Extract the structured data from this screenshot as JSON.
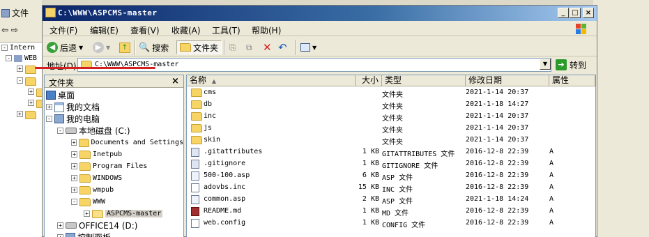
{
  "background": {
    "left_labels": [
      "文件",
      "Intern",
      "WEB"
    ],
    "right_strip": ""
  },
  "window": {
    "title": "C:\\WWW\\ASPCMS-master",
    "controls": {
      "minimize": "_",
      "maximize": "□",
      "close": "×"
    }
  },
  "menu": [
    "文件(F)",
    "编辑(E)",
    "查看(V)",
    "收藏(A)",
    "工具(T)",
    "帮助(H)"
  ],
  "toolbar": {
    "back": "后退",
    "search": "搜索",
    "folders": "文件夹"
  },
  "address": {
    "label": "地址(D)",
    "value": "C:\\WWW\\ASPCMS-master",
    "go": "转到"
  },
  "folders_panel": {
    "title": "文件夹",
    "close": "×",
    "tree": [
      {
        "label": "桌面",
        "level": 0,
        "icon": "desktop-icon"
      },
      {
        "label": "我的文档",
        "level": 1,
        "icon": "documents-icon",
        "expander": "+"
      },
      {
        "label": "我的电脑",
        "level": 1,
        "icon": "computer-icon",
        "expander": "-"
      },
      {
        "label": "本地磁盘 (C:)",
        "level": 2,
        "icon": "drive-icon",
        "expander": "-"
      },
      {
        "label": "Documents and Settings",
        "level": 3,
        "icon": "folder-icon",
        "expander": "+"
      },
      {
        "label": "Inetpub",
        "level": 3,
        "icon": "folder-icon",
        "expander": "+"
      },
      {
        "label": "Program Files",
        "level": 3,
        "icon": "folder-icon",
        "expander": "+"
      },
      {
        "label": "WINDOWS",
        "level": 3,
        "icon": "folder-icon",
        "expander": "+"
      },
      {
        "label": "wmpub",
        "level": 3,
        "icon": "folder-icon",
        "expander": "+"
      },
      {
        "label": "WWW",
        "level": 3,
        "icon": "folder-icon",
        "expander": "-"
      },
      {
        "label": "ASPCMS-master",
        "level": 4,
        "icon": "folder-icon",
        "expander": "+",
        "selected": true
      },
      {
        "label": "OFFICE14 (D:)",
        "level": 2,
        "icon": "drive-icon",
        "expander": "+"
      },
      {
        "label": "控制面板",
        "level": 2,
        "icon": "control-panel-icon",
        "expander": "+"
      }
    ]
  },
  "file_list": {
    "columns": [
      "名称",
      "大小",
      "类型",
      "修改日期",
      "属性"
    ],
    "rows": [
      {
        "name": "cms",
        "size": "",
        "type": "文件夹",
        "date": "2021-1-14 20:37",
        "attr": "",
        "icon": "folder"
      },
      {
        "name": "db",
        "size": "",
        "type": "文件夹",
        "date": "2021-1-18 14:27",
        "attr": "",
        "icon": "folder"
      },
      {
        "name": "inc",
        "size": "",
        "type": "文件夹",
        "date": "2021-1-14 20:37",
        "attr": "",
        "icon": "folder"
      },
      {
        "name": "js",
        "size": "",
        "type": "文件夹",
        "date": "2021-1-14 20:37",
        "attr": "",
        "icon": "folder"
      },
      {
        "name": "skin",
        "size": "",
        "type": "文件夹",
        "date": "2021-1-14 20:37",
        "attr": "",
        "icon": "folder"
      },
      {
        "name": ".gitattributes",
        "size": "1 KB",
        "type": "GITATTRIBUTES 文件",
        "date": "2016-12-8 22:39",
        "attr": "A",
        "icon": "gen"
      },
      {
        "name": ".gitignore",
        "size": "1 KB",
        "type": "GITIGNORE 文件",
        "date": "2016-12-8 22:39",
        "attr": "A",
        "icon": "gen"
      },
      {
        "name": "500-100.asp",
        "size": "6 KB",
        "type": "ASP 文件",
        "date": "2016-12-8 22:39",
        "attr": "A",
        "icon": "asp"
      },
      {
        "name": "adovbs.inc",
        "size": "15 KB",
        "type": "INC 文件",
        "date": "2016-12-8 22:39",
        "attr": "A",
        "icon": "file"
      },
      {
        "name": "common.asp",
        "size": "2 KB",
        "type": "ASP 文件",
        "date": "2021-1-18 14:24",
        "attr": "A",
        "icon": "asp"
      },
      {
        "name": "README.md",
        "size": "1 KB",
        "type": "MD 文件",
        "date": "2016-12-8 22:39",
        "attr": "A",
        "icon": "md"
      },
      {
        "name": "web.config",
        "size": "1 KB",
        "type": "CONFIG 文件",
        "date": "2016-12-8 22:39",
        "attr": "A",
        "icon": "file"
      }
    ]
  }
}
